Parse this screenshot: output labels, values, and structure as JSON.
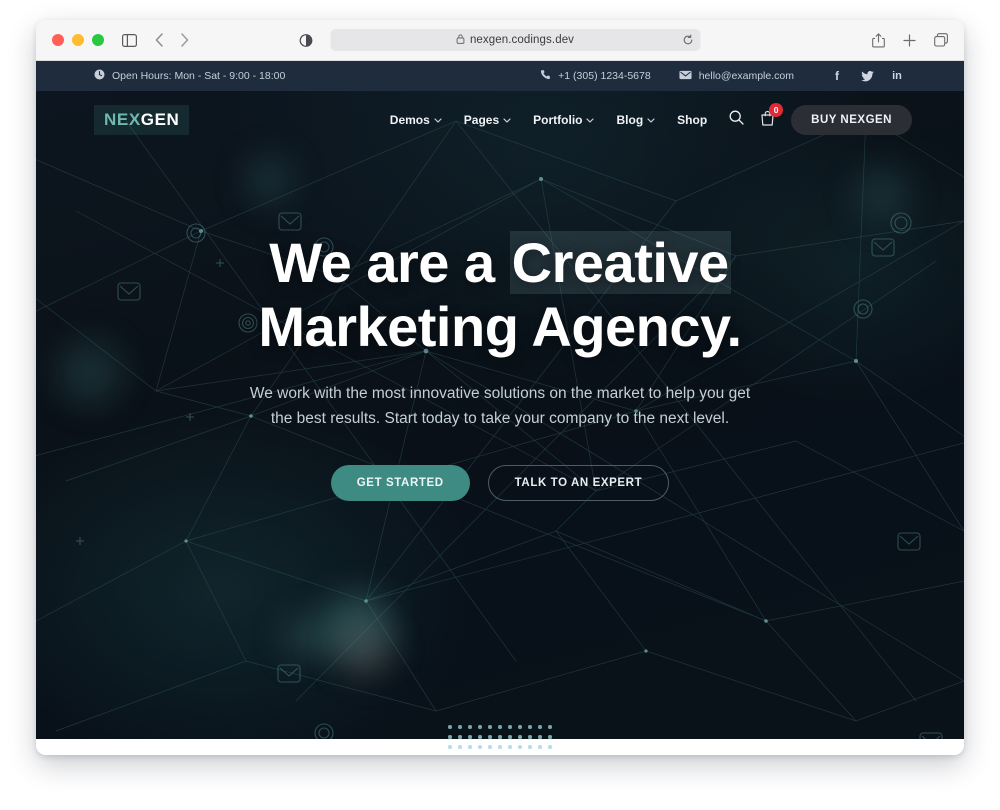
{
  "browser": {
    "url": "nexgen.codings.dev",
    "lock_icon": "lock-icon",
    "reload_icon": "reload-icon",
    "sidebar_icon": "sidebar-icon",
    "back_icon": "back-arrow-icon",
    "forward_icon": "forward-arrow-icon",
    "reader_icon": "reader-mode-icon",
    "share_icon": "share-icon",
    "newtab_icon": "plus-icon",
    "tabs_icon": "tab-overview-icon",
    "traffic_lights": [
      "close",
      "minimize",
      "maximize"
    ]
  },
  "topbar": {
    "hours": "Open Hours: Mon - Sat - 9:00 - 18:00",
    "phone": "+1 (305) 1234-5678",
    "email": "hello@example.com",
    "socials": [
      {
        "name": "facebook",
        "glyph": "f"
      },
      {
        "name": "twitter",
        "glyph": "ᵛ"
      },
      {
        "name": "linkedin",
        "glyph": "in"
      }
    ],
    "bg_color": "#1e2c3d"
  },
  "nav": {
    "logo_part1": "NEX",
    "logo_part2": "GEN",
    "items": [
      {
        "label": "Demos",
        "has_dropdown": true
      },
      {
        "label": "Pages",
        "has_dropdown": true
      },
      {
        "label": "Portfolio",
        "has_dropdown": true
      },
      {
        "label": "Blog",
        "has_dropdown": true
      },
      {
        "label": "Shop",
        "has_dropdown": false
      }
    ],
    "chevron": "⌄",
    "search_icon": "search-icon",
    "cart_icon": "shopping-bag-icon",
    "cart_count": "0",
    "cta_label": "BUY NEXGEN"
  },
  "hero": {
    "heading_line1_a": "We are a ",
    "heading_line1_b": "Creative",
    "heading_line2": "Marketing Agency.",
    "sub_line1": "We work with the most innovative solutions on the market to help you get",
    "sub_line2": "the best results. Start today to take your company to the next level.",
    "primary_cta": "GET STARTED",
    "secondary_cta": "TALK TO AN EXPERT",
    "accent_color": "#3d8b83",
    "bg_color": "#0a1118"
  }
}
